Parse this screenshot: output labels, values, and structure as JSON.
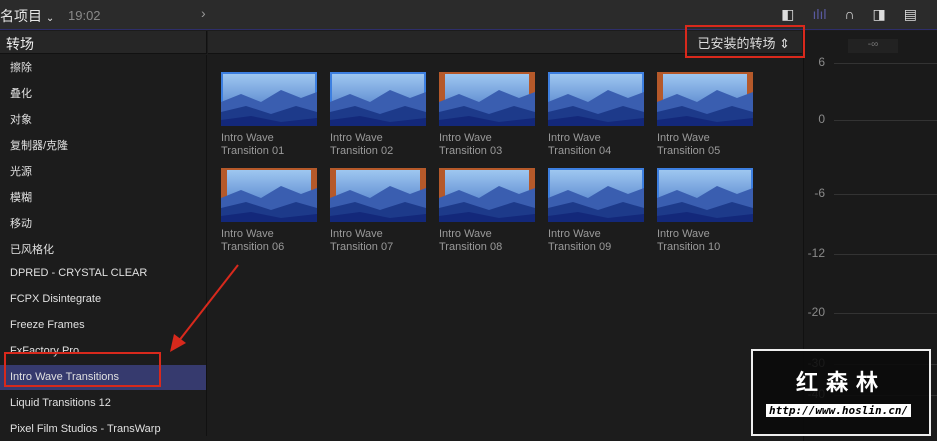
{
  "topbar": {
    "project": "名项目",
    "time": "19:02"
  },
  "sidebar": {
    "title": "转场",
    "items": [
      "擦除",
      "叠化",
      "对象",
      "复制器/克隆",
      "光源",
      "模糊",
      "移动",
      "已风格化",
      "DPRED - CRYSTAL CLEAR",
      "FCPX Disintegrate",
      "Freeze Frames",
      "FxFactory Pro",
      "Intro Wave Transitions",
      "Liquid Transitions 12",
      "Pixel Film Studios - TransWarp"
    ],
    "selected_index": 12
  },
  "browser": {
    "filter": "已安装的转场",
    "items": [
      {
        "line1": "Intro Wave",
        "line2": "Transition 01",
        "orange": false
      },
      {
        "line1": "Intro Wave",
        "line2": "Transition 02",
        "orange": false
      },
      {
        "line1": "Intro Wave",
        "line2": "Transition 03",
        "orange": true
      },
      {
        "line1": "Intro Wave",
        "line2": "Transition 04",
        "orange": false
      },
      {
        "line1": "Intro Wave",
        "line2": "Transition 05",
        "orange": true
      },
      {
        "line1": "Intro Wave",
        "line2": "Transition 06",
        "orange": true
      },
      {
        "line1": "Intro Wave",
        "line2": "Transition 07",
        "orange": true
      },
      {
        "line1": "Intro Wave",
        "line2": "Transition 08",
        "orange": true
      },
      {
        "line1": "Intro Wave",
        "line2": "Transition 09",
        "orange": false
      },
      {
        "line1": "Intro Wave",
        "line2": "Transition 10",
        "orange": false
      }
    ]
  },
  "meter": {
    "peak": "-∞",
    "scale": [
      "6",
      "0",
      "-6",
      "-12",
      "-20",
      "-30",
      "-40"
    ]
  },
  "watermark": {
    "title": "红森林",
    "url": "http://www.hoslin.cn/"
  }
}
